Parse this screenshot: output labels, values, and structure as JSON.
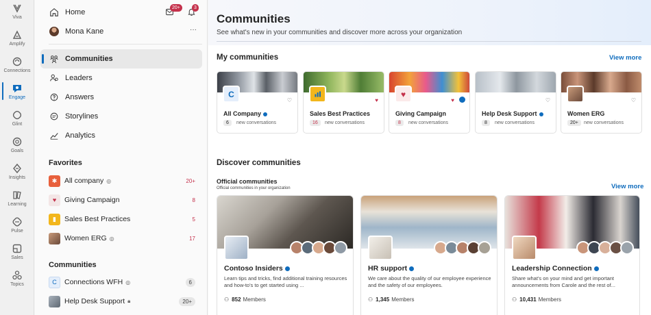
{
  "rail": {
    "items": [
      {
        "label": "Viva",
        "icon": "viva-icon"
      },
      {
        "label": "Amplify",
        "icon": "amplify-icon"
      },
      {
        "label": "Connections",
        "icon": "connections-icon"
      },
      {
        "label": "Engage",
        "icon": "engage-icon"
      },
      {
        "label": "Glint",
        "icon": "glint-icon"
      },
      {
        "label": "Goals",
        "icon": "goals-icon"
      },
      {
        "label": "Insights",
        "icon": "insights-icon"
      },
      {
        "label": "Learning",
        "icon": "learning-icon"
      },
      {
        "label": "Pulse",
        "icon": "pulse-icon"
      },
      {
        "label": "Sales",
        "icon": "sales-icon"
      },
      {
        "label": "Topics",
        "icon": "topics-icon"
      }
    ]
  },
  "nav": {
    "home": "Home",
    "messages_badge": "20+",
    "notifications_badge": "3",
    "user": "Mona Kane",
    "more": "···",
    "items": [
      {
        "label": "Communities",
        "icon": "communities-icon"
      },
      {
        "label": "Leaders",
        "icon": "leaders-icon"
      },
      {
        "label": "Answers",
        "icon": "answers-icon"
      },
      {
        "label": "Storylines",
        "icon": "storylines-icon"
      },
      {
        "label": "Analytics",
        "icon": "analytics-icon"
      }
    ],
    "favorites_title": "Favorites",
    "favorites": [
      {
        "label": "All company",
        "count": "20+"
      },
      {
        "label": "Giving Campaign",
        "count": "8"
      },
      {
        "label": "Sales Best Practices",
        "count": "5"
      },
      {
        "label": "Women ERG",
        "count": "17"
      }
    ],
    "communities_title": "Communities",
    "communities": [
      {
        "label": "Connections WFH",
        "count": "6"
      },
      {
        "label": "Help Desk Support",
        "count": "20+"
      }
    ]
  },
  "main": {
    "title": "Communities",
    "subtitle": "See what's new in your communities and discover more across your organization",
    "my_title": "My communities",
    "view_more": "View more",
    "my_communities": [
      {
        "name": "All Company",
        "count": "6",
        "label": "new conversations"
      },
      {
        "name": "Sales Best Practices",
        "count": "16",
        "label": "new conversations"
      },
      {
        "name": "Giving Campaign",
        "count": "8",
        "label": "new conversations"
      },
      {
        "name": "Help Desk Support",
        "count": "8",
        "label": "new conversations"
      },
      {
        "name": "Women ERG",
        "count": "20+",
        "label": "new conversations"
      }
    ],
    "discover_title": "Discover communities",
    "official_title": "Official communities",
    "official_sub": "Official communities in your organization",
    "official": [
      {
        "name": "Contoso Insiders",
        "desc": "Learn tips and tricks, find additional training resources and how-to's to get started using ...",
        "members": "852",
        "members_label": "Members"
      },
      {
        "name": "HR support",
        "desc": "We care about the quality of our employee experience and the safety of our employees.",
        "members": "1,345",
        "members_label": "Members"
      },
      {
        "name": "Leadership Connection",
        "desc": "Share what's on your mind and get important announcements from Carole and the rest of...",
        "members": "10,431",
        "members_label": "Members"
      }
    ]
  },
  "colors": {
    "accent": "#0f6cbd",
    "alert": "#c4314b"
  }
}
